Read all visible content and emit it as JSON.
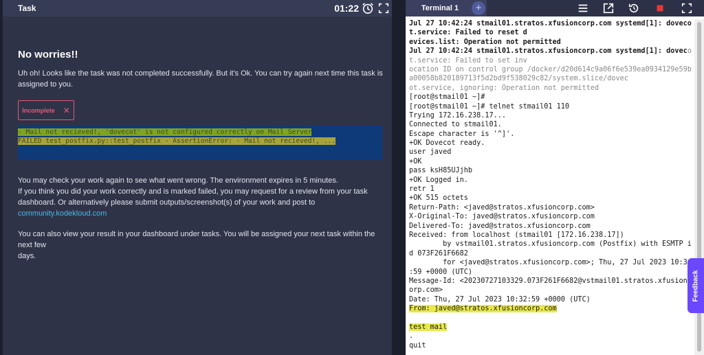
{
  "task": {
    "title": "Task",
    "timer": "01:22",
    "heading": "No worries!!",
    "intro_line1": "Uh oh! Looks like the task was not completed successfully. But it's Ok. You can try again next time this task is",
    "intro_line2": "assigned to you.",
    "status_label": "Incomplete",
    "status_close": "✕",
    "error_line1": "- Mail not recieved!, 'dovecot' is not configured correctly on Mail Server",
    "error_line2": "FAILED test_postfix.py::test_postfix - AssertionError: - Mail not recieved!, ...",
    "check_line1": "You may check your work again to see what went wrong. The environment expires in 5 minutes.",
    "check_line2": "If you think you did your work correctly and is marked failed, you may request for a review from your task",
    "check_line3_pre": "dashboard. Or alternatively please submit outputs/screenshot(s) of your work and post to ",
    "check_link": "community.kodekloud.com",
    "result_line1": "You can also view your result in your dashboard under tasks. You will be assigned your next task within the next few",
    "result_line2": "days."
  },
  "terminal": {
    "tab_label": "Terminal 1",
    "add_tab": "+",
    "lines": [
      {
        "text": "Jul 27 10:42:24 stmail01.stratos.xfusioncorp.com systemd[1]: doveco",
        "style": "bold"
      },
      {
        "text": "t.service: Failed to reset d",
        "style": "bold"
      },
      {
        "text": "evices.list: Operation not permitted",
        "style": "bold"
      },
      {
        "text": "Jul 27 10:42:24 stmail01.stratos.xfusioncorp.com systemd[1]: doveco",
        "style": "mixed"
      },
      {
        "text": "t.service: Failed to set inv",
        "style": "gray"
      },
      {
        "text": "ocation ID on control group /docker/d20d614c9a06f6e539ea0934129e59b",
        "style": "gray"
      },
      {
        "text": "a00058b820189713f5d2bd9f538029c82/system.slice/dovec",
        "style": "gray"
      },
      {
        "text": "ot.service, ignoring: Operation not permitted",
        "style": "gray"
      },
      {
        "text": "[root@stmail01 ~]#",
        "style": "normal"
      },
      {
        "text": "[root@stmail01 ~]# telnet stmail01 110",
        "style": "normal"
      },
      {
        "text": "Trying 172.16.238.17...",
        "style": "normal"
      },
      {
        "text": "Connected to stmail01.",
        "style": "normal"
      },
      {
        "text": "Escape character is '^]'.",
        "style": "normal"
      },
      {
        "text": "+OK Dovecot ready.",
        "style": "normal"
      },
      {
        "text": "user javed",
        "style": "normal"
      },
      {
        "text": "+OK",
        "style": "normal"
      },
      {
        "text": "pass ksH85UJjhb",
        "style": "normal"
      },
      {
        "text": "+OK Logged in.",
        "style": "normal"
      },
      {
        "text": "retr 1",
        "style": "normal"
      },
      {
        "text": "+OK 515 octets",
        "style": "normal"
      },
      {
        "text": "Return-Path: <javed@stratos.xfusioncorp.com>",
        "style": "normal"
      },
      {
        "text": "X-Original-To: javed@stratos.xfusioncorp.com",
        "style": "normal"
      },
      {
        "text": "Delivered-To: javed@stratos.xfusioncorp.com",
        "style": "normal"
      },
      {
        "text": "Received: from localhost (stmail01 [172.16.238.17])",
        "style": "normal"
      },
      {
        "text": "        by vstmail01.stratos.xfusioncorp.com (Postfix) with ESMTP i",
        "style": "normal"
      },
      {
        "text": "d 073F261F6682",
        "style": "normal"
      },
      {
        "text": "        for <javed@stratos.xfusioncorp.com>; Thu, 27 Jul 2023 10:3",
        "style": "normal"
      },
      {
        "text": ":59 +0000 (UTC)",
        "style": "normal"
      },
      {
        "text": "Message-Id: <20230727103329.073F261F6682@vstmail01.stratos.xfusionc",
        "style": "normal"
      },
      {
        "text": "orp.com>",
        "style": "normal"
      },
      {
        "text": "Date: Thu, 27 Jul 2023 10:32:59 +0000 (UTC)",
        "style": "normal"
      },
      {
        "text": "From: javed@stratos.xfusioncorp.com",
        "style": "yellow"
      },
      {
        "text": "",
        "style": "normal"
      },
      {
        "text": "test mail",
        "style": "yellow"
      },
      {
        "text": ".",
        "style": "normal"
      },
      {
        "text": "quit",
        "style": "normal"
      }
    ],
    "mixed_gray_tail": "o"
  },
  "feedback": {
    "label": "Feedback"
  },
  "icons": {
    "alarm": "alarm-clock-icon",
    "fullscreen": "fullscreen-icon",
    "menu": "hamburger-menu-icon",
    "popout": "external-link-icon",
    "reset": "reset-icon",
    "stop": "stop-icon"
  },
  "colors": {
    "accent_red": "#e05a7b",
    "link": "#4db6e6",
    "stop": "#e53935",
    "feedback": "#6b48ff",
    "highlight": "#e8e84c"
  }
}
